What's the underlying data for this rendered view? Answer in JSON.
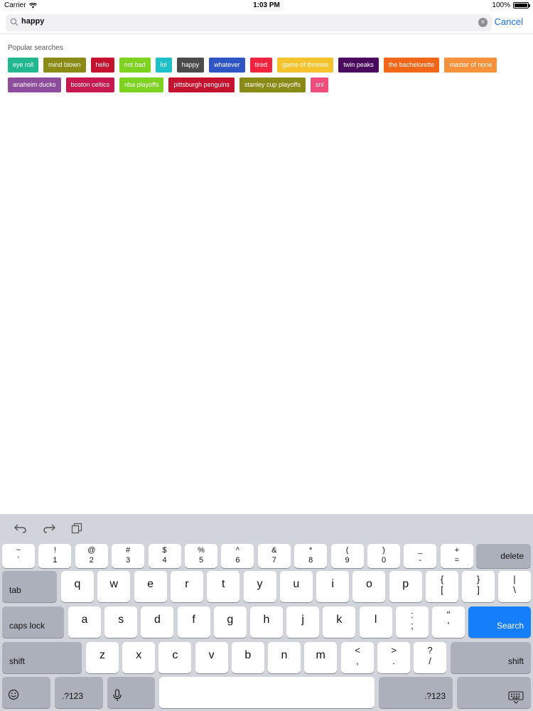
{
  "status_bar": {
    "carrier": "Carrier",
    "time": "1:03 PM",
    "battery_text": "100%",
    "battery_level": 1.0
  },
  "search": {
    "query": "happy",
    "cancel_label": "Cancel"
  },
  "popular": {
    "title": "Popular searches",
    "tags": [
      {
        "label": "eye roll",
        "color": "#21b88f"
      },
      {
        "label": "mind blown",
        "color": "#8a8a16"
      },
      {
        "label": "hello",
        "color": "#c4122f"
      },
      {
        "label": "not bad",
        "color": "#7ed321"
      },
      {
        "label": "lol",
        "color": "#1fc1c8"
      },
      {
        "label": "happy",
        "color": "#4a4a4a"
      },
      {
        "label": "whatever",
        "color": "#2f55c4"
      },
      {
        "label": "tired",
        "color": "#f0243f"
      },
      {
        "label": "game of thrones",
        "color": "#f5c32c"
      },
      {
        "label": "twin peaks",
        "color": "#4a0b5e"
      },
      {
        "label": "the bachelorette",
        "color": "#f2661a"
      },
      {
        "label": "master of none",
        "color": "#f7923a"
      },
      {
        "label": "anaheim ducks",
        "color": "#8e4d9c"
      },
      {
        "label": "boston celtics",
        "color": "#c7194f"
      },
      {
        "label": "nba playoffs",
        "color": "#7ed321"
      },
      {
        "label": "pittsburgh penguins",
        "color": "#c4122f"
      },
      {
        "label": "stanley cup playoffs",
        "color": "#8a8a16"
      },
      {
        "label": "snl",
        "color": "#f04d7e"
      }
    ]
  },
  "keyboard": {
    "toolbar_icons": [
      "undo-icon",
      "redo-icon",
      "paste-icon"
    ],
    "number_row": [
      {
        "top": "~",
        "bottom": "`"
      },
      {
        "top": "!",
        "bottom": "1"
      },
      {
        "top": "@",
        "bottom": "2"
      },
      {
        "top": "#",
        "bottom": "3"
      },
      {
        "top": "$",
        "bottom": "4"
      },
      {
        "top": "%",
        "bottom": "5"
      },
      {
        "top": "^",
        "bottom": "6"
      },
      {
        "top": "&",
        "bottom": "7"
      },
      {
        "top": "*",
        "bottom": "8"
      },
      {
        "top": "(",
        "bottom": "9"
      },
      {
        "top": ")",
        "bottom": "0"
      },
      {
        "top": "_",
        "bottom": "-"
      },
      {
        "top": "+",
        "bottom": "="
      }
    ],
    "delete_label": "delete",
    "tab_label": "tab",
    "row1": [
      "q",
      "w",
      "e",
      "r",
      "t",
      "y",
      "u",
      "i",
      "o",
      "p"
    ],
    "row1_syms": [
      {
        "top": "{",
        "bottom": "["
      },
      {
        "top": "}",
        "bottom": "]"
      },
      {
        "top": "|",
        "bottom": "\\"
      }
    ],
    "caps_label": "caps lock",
    "row2": [
      "a",
      "s",
      "d",
      "f",
      "g",
      "h",
      "j",
      "k",
      "l"
    ],
    "row2_syms": [
      {
        "top": ":",
        "bottom": ";"
      },
      {
        "top": "\"",
        "bottom": "'"
      }
    ],
    "search_label": "Search",
    "shift_label": "shift",
    "row3": [
      "z",
      "x",
      "c",
      "v",
      "b",
      "n",
      "m"
    ],
    "row3_syms": [
      {
        "top": "<",
        "bottom": ","
      },
      {
        "top": ">",
        "bottom": "."
      },
      {
        "top": "?",
        "bottom": "/"
      }
    ],
    "numbers_label": ".?123",
    "emoji_icon": "emoji-icon",
    "mic_icon": "microphone-icon",
    "dismiss_icon": "keyboard-dismiss-icon",
    "colors": {
      "background": "#d1d4da",
      "key": "#ffffff",
      "special_key": "#abb0ba",
      "accent": "#157efb"
    }
  }
}
